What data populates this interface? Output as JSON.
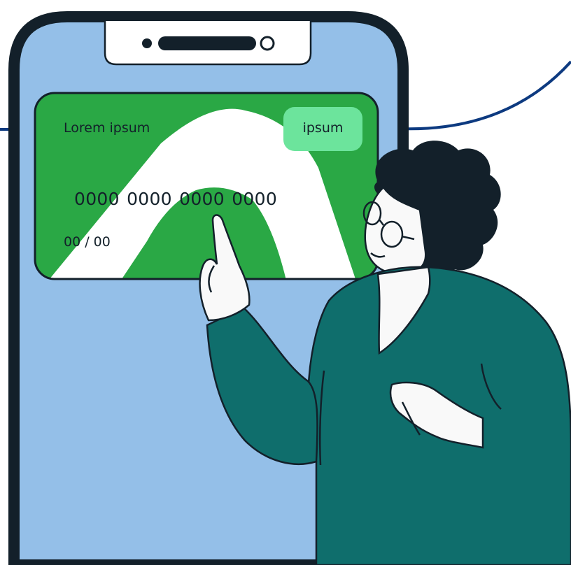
{
  "card": {
    "brand_label": "Lorem ipsum",
    "badge_label": "ipsum",
    "number": "0000 0000 0000 0000",
    "expiry": "00 / 00"
  },
  "colors": {
    "phone_frame": "#13202a",
    "phone_screen": "#94bfe8",
    "card_green": "#2aa845",
    "badge_green": "#6ce49c",
    "sweater": "#0f6e6c",
    "skin": "#f9f9f9",
    "hair": "#13202a",
    "line_navy": "#0d3a80"
  },
  "icons": [
    "phone-speaker-icon",
    "phone-camera-icon",
    "card-swoosh-icon"
  ]
}
